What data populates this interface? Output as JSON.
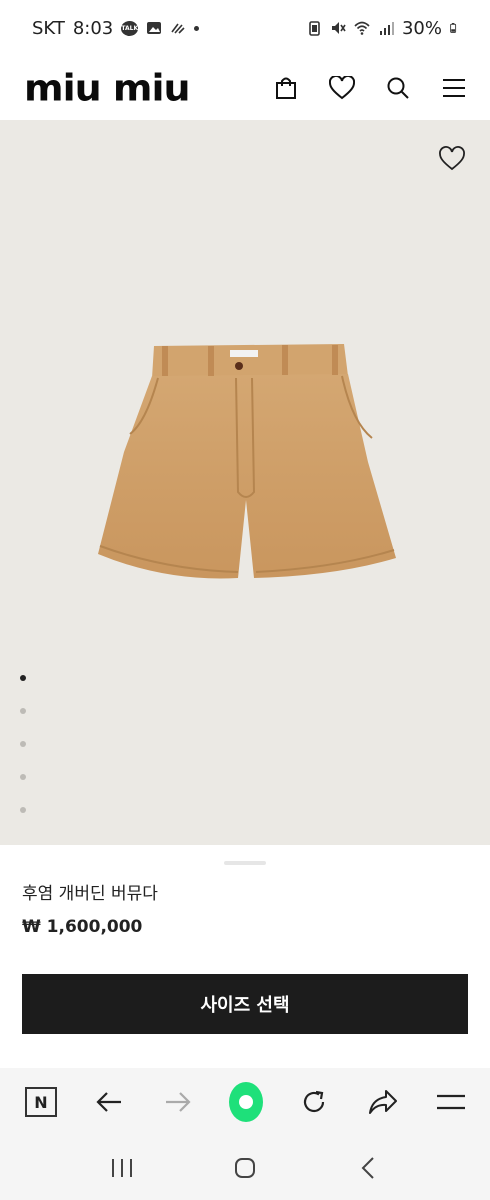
{
  "status_bar": {
    "carrier": "SKT",
    "time": "8:03",
    "battery": "30%",
    "talk_badge": "TALK"
  },
  "header": {
    "logo_text": "miu miu",
    "icons": [
      "bag-icon",
      "heart-icon",
      "search-icon",
      "menu-icon"
    ]
  },
  "product": {
    "name": "후염 개버딘 버뮤다",
    "price": "₩ 1,600,000",
    "image_alt": "shorts-image",
    "carousel": {
      "total": 5,
      "active_index": 0
    },
    "size_button_label": "사이즈 선택"
  },
  "browser_toolbar": {
    "n_label": "N",
    "icons": [
      "naver-icon",
      "back-arrow-icon",
      "forward-arrow-icon",
      "home-icon",
      "refresh-icon",
      "share-icon",
      "menu-icon"
    ],
    "accent": "#1ee07a"
  },
  "nav_bar": {
    "icons": [
      "recent-apps-icon",
      "home-icon",
      "back-icon"
    ]
  }
}
